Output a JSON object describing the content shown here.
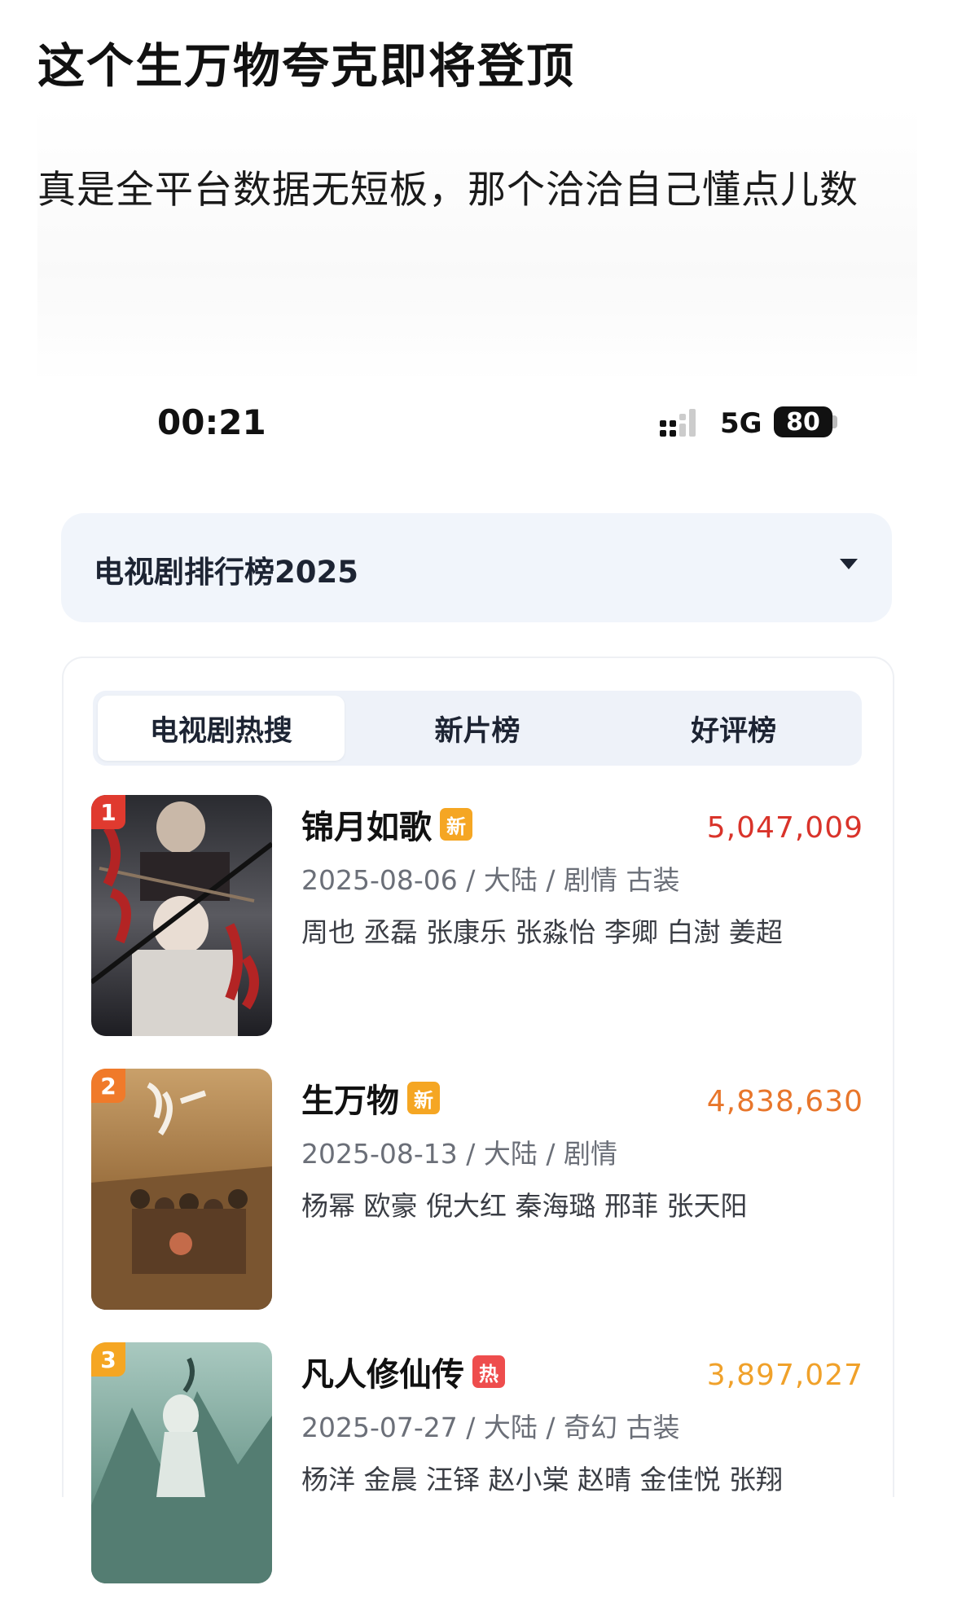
{
  "post": {
    "title": "这个生万物夸克即将登顶",
    "body": "真是全平台数据无短板，那个洽洽自己懂点儿数"
  },
  "status_bar": {
    "time": "00:21",
    "network": "5G",
    "battery": "80"
  },
  "dropdown": {
    "label": "电视剧排行榜2025"
  },
  "tabs": [
    {
      "label": "电视剧热搜",
      "active": true
    },
    {
      "label": "新片榜",
      "active": false
    },
    {
      "label": "好评榜",
      "active": false
    }
  ],
  "rankings": [
    {
      "rank": "1",
      "title": "锦月如歌",
      "tag": "新",
      "score": "5,047,009",
      "meta": "2025-08-06 / 大陆 / 剧情 古装",
      "cast": "周也 丞磊 张康乐 张淼怡 李卿 白澍 姜超"
    },
    {
      "rank": "2",
      "title": "生万物",
      "tag": "新",
      "score": "4,838,630",
      "meta": "2025-08-13 / 大陆 / 剧情",
      "cast": "杨幂 欧豪 倪大红 秦海璐 邢菲 张天阳"
    },
    {
      "rank": "3",
      "title": "凡人修仙传",
      "tag": "热",
      "score": "3,897,027",
      "meta": "2025-07-27 / 大陆 / 奇幻 古装",
      "cast": "杨洋 金晨 汪铎 赵小棠 赵晴 金佳悦 张翔"
    }
  ],
  "colors": {
    "rank1": "#e03a2f",
    "rank2": "#f07a2a",
    "rank3": "#f5a623",
    "score1": "#d9332a",
    "score2": "#e8762b",
    "score3": "#f0a12a",
    "tag_new": "#f5a623",
    "tag_hot": "#ee4d4d"
  }
}
